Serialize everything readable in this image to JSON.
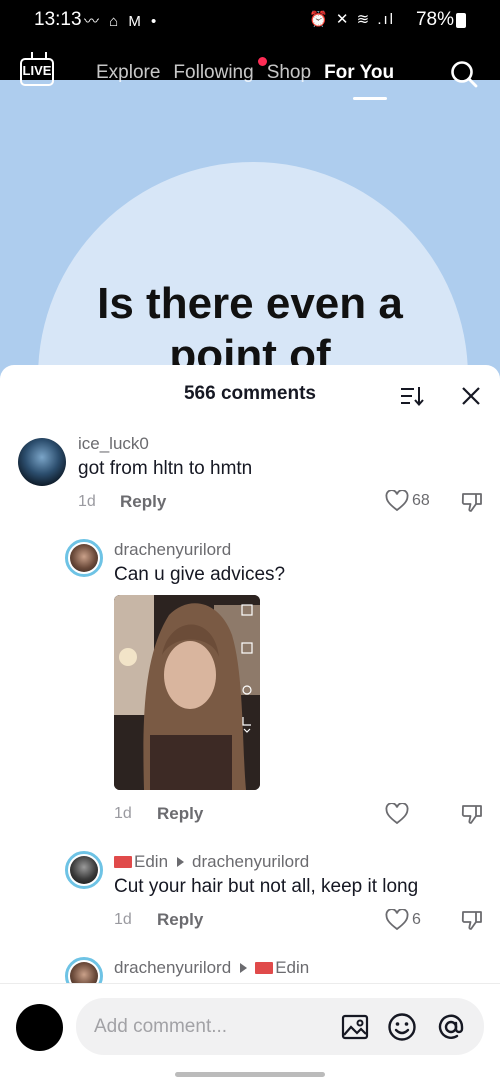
{
  "status_bar": {
    "time": "13:13",
    "left_icons": "〰 ⌂ M •",
    "battery": "78%"
  },
  "nav": {
    "live_label": "LIVE",
    "tabs": [
      "Explore",
      "Following",
      "Shop",
      "For You"
    ],
    "active_tab": "For You"
  },
  "video": {
    "title_line1": "Is there even a",
    "title_line2": "point of"
  },
  "comments_sheet": {
    "count_label": "566 comments",
    "comments": [
      {
        "username": "ice_luck0",
        "text": "got from hltn to hmtn",
        "time": "1d",
        "reply_label": "Reply",
        "likes": "68"
      },
      {
        "username": "drachenyurilord",
        "text": "Can u give advices?",
        "time": "1d",
        "reply_label": "Reply",
        "likes": "",
        "has_photo": true
      },
      {
        "username": "Edin",
        "reply_to": "drachenyurilord",
        "text": "Cut your hair but not all, keep it long",
        "time": "1d",
        "reply_label": "Reply",
        "likes": "6"
      },
      {
        "username": "drachenyurilord",
        "reply_to": "Edin"
      }
    ]
  },
  "input": {
    "placeholder": "Add comment..."
  },
  "colors": {
    "video_bg": "#aecdee",
    "shape": "#d7e6f7",
    "accent_ring": "#6ec3e5",
    "notification": "#fe2c55"
  }
}
